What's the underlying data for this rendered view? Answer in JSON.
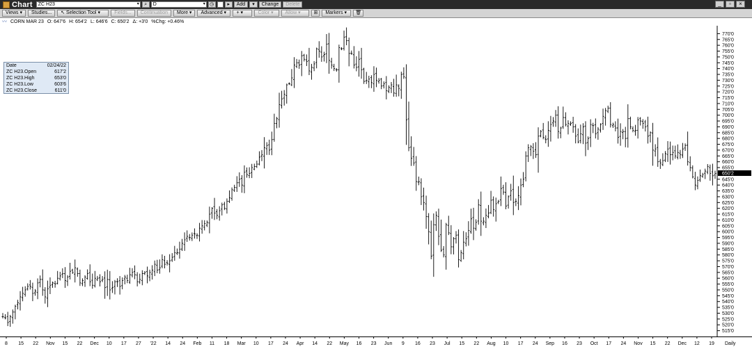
{
  "window": {
    "title": "Chart",
    "symbol_value": "ZC H23",
    "secondary_value": "D",
    "buttons": {
      "add": "Add",
      "change": "Change",
      "delete": "Delete"
    },
    "controls": {
      "minimize": "_",
      "restore": "▫",
      "close": "×"
    }
  },
  "toolbar": {
    "views": "Views",
    "studies": "Studies...",
    "selection_tool": "Selection Tool",
    "fields": "Fields...",
    "continuation": "Continuation",
    "more": "More",
    "advanced": "Advanced",
    "crosshair": "+",
    "color": "Color",
    "allow": "Allow",
    "markers": "Markers"
  },
  "header": {
    "contract": "CORN MAR 23",
    "open": "O: 647'6",
    "high": "H: 654'2",
    "low": "L: 646'6",
    "close": "C: 650'2",
    "change": "Δ: +3'0",
    "pct_change": "%Chg: +0.46%"
  },
  "data_window": {
    "rows": [
      {
        "label": "Date",
        "value": "02/24/22"
      },
      {
        "label": "ZC H23.Open",
        "value": "617'2"
      },
      {
        "label": "ZC H23.High",
        "value": "653'0"
      },
      {
        "label": "ZC H23.Low",
        "value": "603'6"
      },
      {
        "label": "ZC H23.Close",
        "value": "611'0"
      }
    ]
  },
  "chart_data": {
    "type": "ohlc",
    "interval_label": "Daily",
    "last_price_label": "650'2",
    "last_price": 650.25,
    "ylim": [
      510,
      775
    ],
    "y_ticks": [
      "770'0",
      "765'0",
      "760'0",
      "755'0",
      "750'0",
      "745'0",
      "740'0",
      "735'0",
      "730'0",
      "725'0",
      "720'0",
      "715'0",
      "710'0",
      "705'0",
      "700'0",
      "695'0",
      "690'0",
      "685'0",
      "680'0",
      "675'0",
      "670'0",
      "665'0",
      "660'0",
      "655'0",
      "650'0",
      "645'0",
      "640'0",
      "635'0",
      "630'0",
      "625'0",
      "620'0",
      "615'0",
      "610'0",
      "605'0",
      "600'0",
      "595'0",
      "590'0",
      "585'0",
      "580'0",
      "575'0",
      "570'0",
      "565'0",
      "560'0",
      "555'0",
      "550'0",
      "545'0",
      "540'0",
      "535'0",
      "530'0",
      "525'0",
      "520'0",
      "515'0"
    ],
    "x_ticks": [
      "8",
      "15",
      "22",
      "Nov",
      "15",
      "22",
      "Dec",
      "10",
      "17",
      "27",
      "'22",
      "14",
      "24",
      "Feb",
      "11",
      "18",
      "Mar",
      "10",
      "17",
      "24",
      "Apr",
      "14",
      "22",
      "May",
      "16",
      "23",
      "Jun",
      "9",
      "16",
      "23",
      "Jul",
      "15",
      "22",
      "Aug",
      "10",
      "17",
      "24",
      "Sep",
      "16",
      "23",
      "Oct",
      "17",
      "24",
      "Nov",
      "15",
      "22",
      "Dec",
      "12",
      "19"
    ],
    "close_path": [
      527,
      526,
      522,
      527,
      531,
      536,
      539,
      544,
      547,
      550,
      553,
      553,
      547,
      549,
      556,
      559,
      550,
      544,
      551,
      554,
      556,
      555,
      560,
      562,
      564,
      558,
      561,
      566,
      565,
      569,
      564,
      556,
      558,
      561,
      564,
      557,
      554,
      560,
      560,
      557,
      559,
      552,
      559,
      550,
      552,
      557,
      557,
      553,
      558,
      561,
      558,
      563,
      565,
      563,
      557,
      559,
      564,
      565,
      562,
      565,
      567,
      572,
      567,
      569,
      576,
      572,
      573,
      575,
      578,
      582,
      582,
      585,
      590,
      593,
      596,
      595,
      597,
      598,
      597,
      603,
      605,
      607,
      608,
      615,
      620,
      616,
      614,
      618,
      623,
      620,
      626,
      629,
      636,
      638,
      642,
      645,
      640,
      651,
      649,
      650,
      655,
      656,
      658,
      664,
      666,
      672,
      674,
      670,
      679,
      693,
      697,
      709,
      714,
      718,
      726,
      727,
      732,
      743,
      745,
      743,
      751,
      748,
      746,
      738,
      741,
      744,
      757,
      755,
      750,
      752,
      761,
      747,
      743,
      740,
      739,
      758,
      757,
      767,
      764,
      753,
      753,
      743,
      741,
      748,
      739,
      729,
      730,
      731,
      728,
      735,
      730,
      730,
      725,
      727,
      721,
      724,
      726,
      719,
      726,
      723,
      735,
      733,
      696,
      672,
      663,
      659,
      643,
      643,
      630,
      625,
      613,
      600,
      579,
      606,
      614,
      596,
      584,
      580,
      606,
      599,
      587,
      594,
      597,
      576,
      582,
      591,
      594,
      601,
      611,
      603,
      608,
      623,
      609,
      609,
      614,
      616,
      627,
      619,
      624,
      626,
      637,
      634,
      622,
      630,
      635,
      625,
      626,
      631,
      640,
      645,
      665,
      672,
      673,
      669,
      666,
      682,
      686,
      681,
      679,
      687,
      692,
      695,
      700,
      686,
      689,
      698,
      692,
      693,
      693,
      690,
      682,
      677,
      684,
      690,
      676,
      680,
      692,
      691,
      684,
      688,
      692,
      699,
      704,
      706,
      692,
      692,
      689,
      681,
      686,
      686,
      680,
      697,
      690,
      687,
      687,
      696,
      695,
      693,
      690,
      682,
      685,
      670,
      671,
      660,
      659,
      661,
      667,
      671,
      666,
      668,
      665,
      668,
      666,
      671,
      674,
      660,
      655,
      647,
      640,
      644,
      648,
      649,
      652,
      656,
      650,
      648,
      650
    ]
  }
}
